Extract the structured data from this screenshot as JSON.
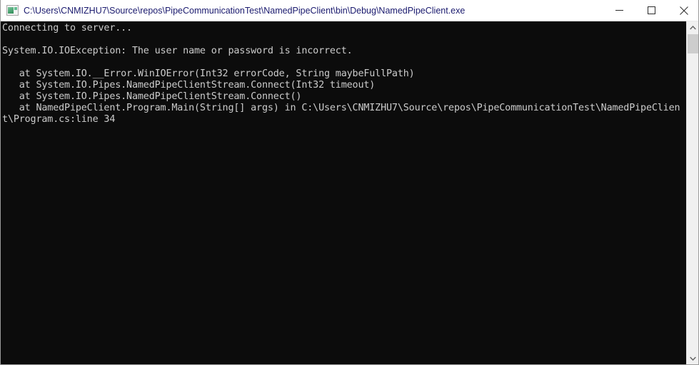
{
  "window": {
    "title": "C:\\Users\\CNMIZHU7\\Source\\repos\\PipeCommunicationTest\\NamedPipeClient\\bin\\Debug\\NamedPipeClient.exe",
    "icon": "console-app-icon",
    "titlebar_background": "#ffffff",
    "title_color": "#1a1a6e",
    "client_background": "#0c0c0c",
    "client_foreground": "#cccccc"
  },
  "caption": {
    "minimize_label": "─",
    "maximize_label": "□",
    "close_label": "✕"
  },
  "console": {
    "lines": [
      "Connecting to server...",
      "",
      "System.IO.IOException: The user name or password is incorrect.",
      "",
      "   at System.IO.__Error.WinIOError(Int32 errorCode, String maybeFullPath)",
      "   at System.IO.Pipes.NamedPipeClientStream.Connect(Int32 timeout)",
      "   at System.IO.Pipes.NamedPipeClientStream.Connect()",
      "   at NamedPipeClient.Program.Main(String[] args) in C:\\Users\\CNMIZHU7\\Source\\repos\\PipeCommunicationTest\\NamedPipeClien",
      "t\\Program.cs:line 34"
    ],
    "text": "Connecting to server...\n\nSystem.IO.IOException: The user name or password is incorrect.\n\n   at System.IO.__Error.WinIOError(Int32 errorCode, String maybeFullPath)\n   at System.IO.Pipes.NamedPipeClientStream.Connect(Int32 timeout)\n   at System.IO.Pipes.NamedPipeClientStream.Connect()\n   at NamedPipeClient.Program.Main(String[] args) in C:\\Users\\CNMIZHU7\\Source\\repos\\PipeCommunicationTest\\NamedPipeClien\nt\\Program.cs:line 34"
  },
  "scrollbar": {
    "up_arrow": "chevron-up-icon",
    "down_arrow": "chevron-down-icon",
    "thumb": "scrollbar-thumb"
  }
}
